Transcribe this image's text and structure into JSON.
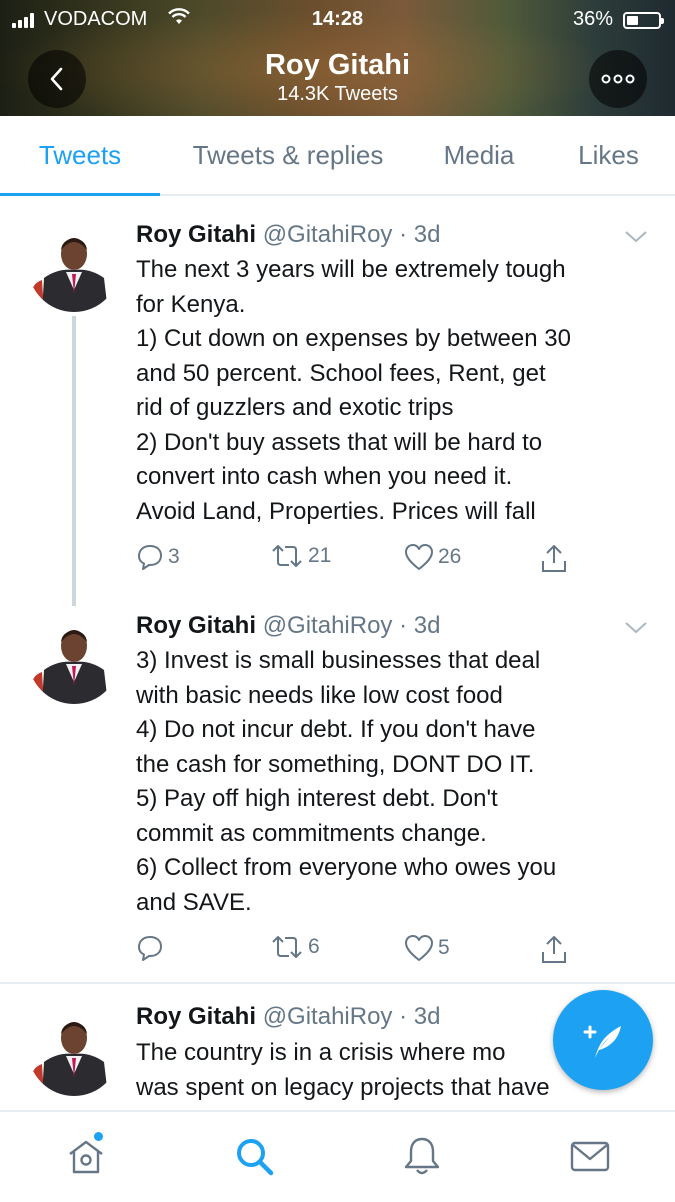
{
  "status_bar": {
    "carrier": "VODACOM",
    "time": "14:28",
    "battery": "36%",
    "battery_level": 0.36
  },
  "header": {
    "name": "Roy Gitahi",
    "tweet_count": "14.3K Tweets"
  },
  "tabs": [
    {
      "label": "Tweets",
      "active": true
    },
    {
      "label": "Tweets & replies",
      "active": false
    },
    {
      "label": "Media",
      "active": false
    },
    {
      "label": "Likes",
      "active": false
    }
  ],
  "tweets": [
    {
      "name": "Roy Gitahi",
      "handle": "@GitahiRoy",
      "time": "· 3d",
      "lines": [
        "The next 3 years will be extremely tough",
        "for Kenya.",
        "1) Cut down on expenses by between 30",
        "and 50 percent. School fees, Rent, get",
        "rid of guzzlers and exotic trips",
        "2) Don't buy assets that will be hard to",
        "convert into cash when you need it.",
        "Avoid Land, Properties. Prices will fall"
      ],
      "replies": "3",
      "retweets": "21",
      "likes": "26"
    },
    {
      "name": "Roy Gitahi",
      "handle": "@GitahiRoy",
      "time": "· 3d",
      "lines": [
        "3) Invest is small businesses that deal",
        "with basic needs like low cost food",
        "4) Do not incur debt. If you don't have",
        "the cash for something, DONT DO IT.",
        "5) Pay off high interest debt. Don't",
        "commit as commitments change.",
        "6) Collect from everyone who owes you",
        "and SAVE."
      ],
      "replies": "",
      "retweets": "6",
      "likes": "5"
    },
    {
      "name": "Roy Gitahi",
      "handle": "@GitahiRoy",
      "time": "· 3d",
      "lines": [
        "The country is in a crisis where mo",
        "was spent on legacy projects that have"
      ]
    }
  ],
  "icons": {
    "back": "back-chevron-icon",
    "more": "more-options-icon",
    "reply": "reply-icon",
    "retweet": "retweet-icon",
    "like": "heart-icon",
    "share": "share-icon",
    "compose": "compose-tweet-icon",
    "home": "home-icon",
    "search": "search-icon",
    "notifications": "bell-icon",
    "messages": "mail-icon"
  },
  "colors": {
    "accent": "#1da1f2",
    "secondary_text": "#657786",
    "divider": "#e6ecf0"
  }
}
